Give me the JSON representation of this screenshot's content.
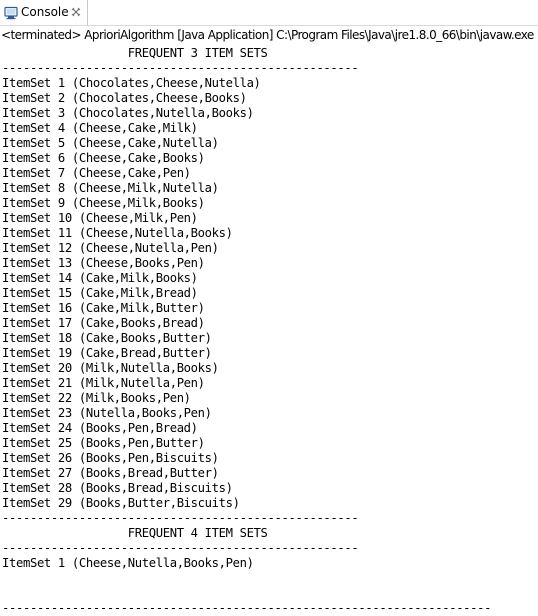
{
  "tab": {
    "label": "Console",
    "icon": "console-icon",
    "close_icon": "close-icon"
  },
  "status_line": "<terminated> AprioriAlgorithm [Java Application] C:\\Program Files\\Java\\jre1.8.0_66\\bin\\javaw.exe (Feb",
  "console_lines": [
    "                  FREQUENT 3 ITEM SETS",
    "---------------------------------------------------",
    "ItemSet 1 (Chocolates,Cheese,Nutella)",
    "ItemSet 2 (Chocolates,Cheese,Books)",
    "ItemSet 3 (Chocolates,Nutella,Books)",
    "ItemSet 4 (Cheese,Cake,Milk)",
    "ItemSet 5 (Cheese,Cake,Nutella)",
    "ItemSet 6 (Cheese,Cake,Books)",
    "ItemSet 7 (Cheese,Cake,Pen)",
    "ItemSet 8 (Cheese,Milk,Nutella)",
    "ItemSet 9 (Cheese,Milk,Books)",
    "ItemSet 10 (Cheese,Milk,Pen)",
    "ItemSet 11 (Cheese,Nutella,Books)",
    "ItemSet 12 (Cheese,Nutella,Pen)",
    "ItemSet 13 (Cheese,Books,Pen)",
    "ItemSet 14 (Cake,Milk,Books)",
    "ItemSet 15 (Cake,Milk,Bread)",
    "ItemSet 16 (Cake,Milk,Butter)",
    "ItemSet 17 (Cake,Books,Bread)",
    "ItemSet 18 (Cake,Books,Butter)",
    "ItemSet 19 (Cake,Bread,Butter)",
    "ItemSet 20 (Milk,Nutella,Books)",
    "ItemSet 21 (Milk,Nutella,Pen)",
    "ItemSet 22 (Milk,Books,Pen)",
    "ItemSet 23 (Nutella,Books,Pen)",
    "ItemSet 24 (Books,Pen,Bread)",
    "ItemSet 25 (Books,Pen,Butter)",
    "ItemSet 26 (Books,Pen,Biscuits)",
    "ItemSet 27 (Books,Bread,Butter)",
    "ItemSet 28 (Books,Bread,Biscuits)",
    "ItemSet 29 (Books,Butter,Biscuits)",
    "---------------------------------------------------",
    "                  FREQUENT 4 ITEM SETS",
    "---------------------------------------------------",
    "ItemSet 1 (Cheese,Nutella,Books,Pen)",
    "",
    "",
    "----------------------------------------------------------------------"
  ]
}
